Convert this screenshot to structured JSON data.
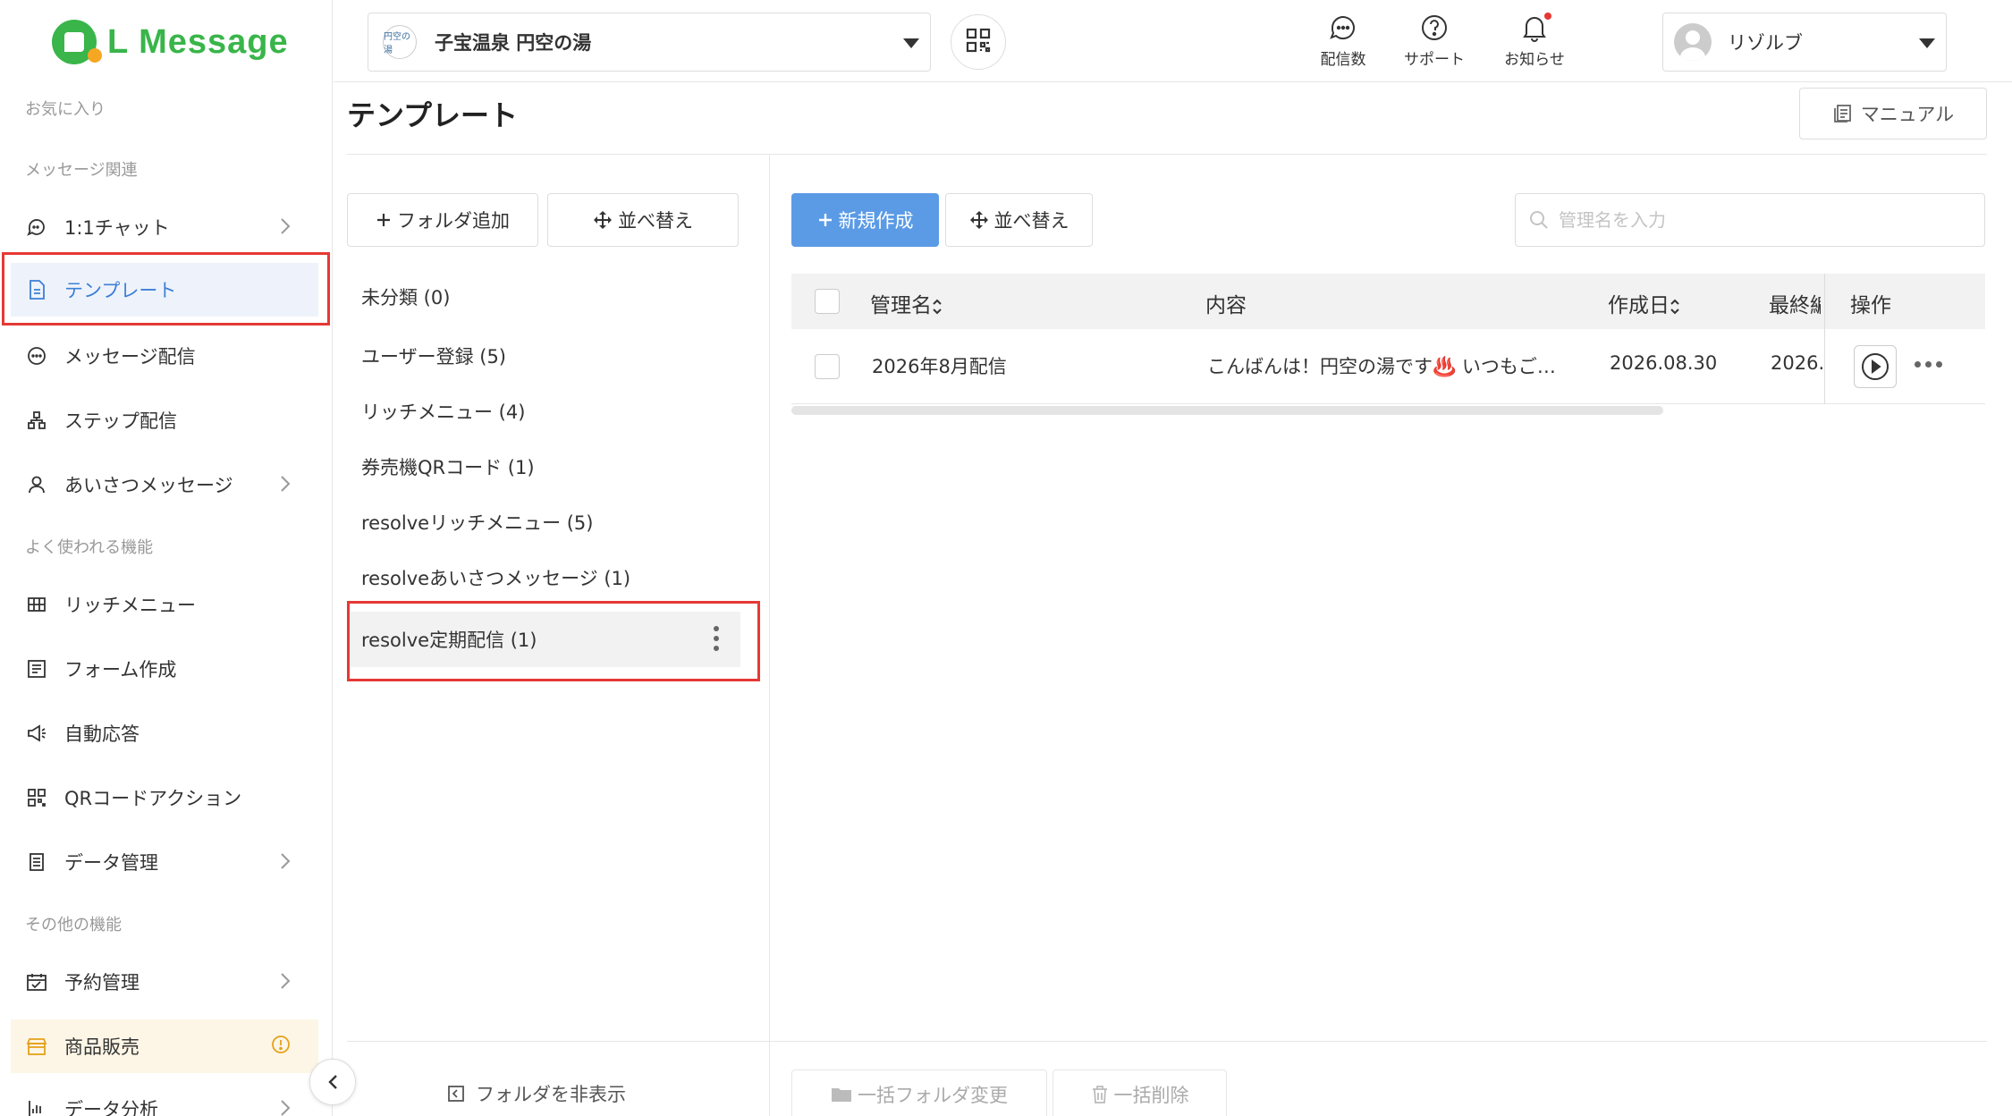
{
  "app": {
    "logo_text": "L Message"
  },
  "header": {
    "account_name": "子宝温泉 円空の湯",
    "account_logo_text": "円空の湯",
    "icons": [
      {
        "name": "message-count",
        "label": "配信数"
      },
      {
        "name": "support",
        "label": "サポート"
      },
      {
        "name": "notifications",
        "label": "お知らせ"
      }
    ],
    "user_name": "リゾルブ"
  },
  "sidebar": {
    "sections": {
      "favorites": "お気に入り",
      "messaging": "メッセージ関連",
      "frequent": "よく使われる機能",
      "other": "その他の機能"
    },
    "items": [
      {
        "label": "1:1チャット",
        "icon": "chat-icon"
      },
      {
        "label": "テンプレート",
        "icon": "document-icon",
        "active": true
      },
      {
        "label": "メッセージ配信",
        "icon": "message-icon"
      },
      {
        "label": "ステップ配信",
        "icon": "step-icon"
      },
      {
        "label": "あいさつメッセージ",
        "icon": "user-icon"
      },
      {
        "label": "リッチメニュー",
        "icon": "grid-icon"
      },
      {
        "label": "フォーム作成",
        "icon": "form-icon"
      },
      {
        "label": "自動応答",
        "icon": "megaphone-icon"
      },
      {
        "label": "QRコードアクション",
        "icon": "qr-icon"
      },
      {
        "label": "データ管理",
        "icon": "data-icon"
      },
      {
        "label": "予約管理",
        "icon": "calendar-icon"
      },
      {
        "label": "商品販売",
        "icon": "shop-icon"
      },
      {
        "label": "データ分析",
        "icon": "chart-icon"
      }
    ]
  },
  "page": {
    "title": "テンプレート",
    "manual_label": "マニュアル"
  },
  "folders": {
    "add_label": "フォルダ追加",
    "sort_label": "並べ替え",
    "items": [
      "未分類 (0)",
      "ユーザー登録 (5)",
      "リッチメニュー (4)",
      "券売機QRコード (1)",
      "resolveリッチメニュー (5)",
      "resolveあいさつメッセージ (1)",
      "resolve定期配信 (1)"
    ],
    "hide_label": "フォルダを非表示"
  },
  "toolbar": {
    "new_label": "新規作成",
    "sort_label": "並べ替え",
    "search_placeholder": "管理名を入力"
  },
  "table": {
    "headers": {
      "name": "管理名",
      "content": "内容",
      "created": "作成日",
      "updated": "最終編",
      "actions": "操作"
    },
    "rows": [
      {
        "name": "2026年8月配信",
        "content": "こんばんは！円空の湯です♨️ いつもご…",
        "created": "2026.08.30",
        "updated": "2026."
      }
    ]
  },
  "bulk": {
    "change_folder": "一括フォルダ変更",
    "delete": "一括削除"
  },
  "colors": {
    "brand": "#39b54a",
    "primary": "#5b9be6",
    "highlight": "#e53935"
  }
}
